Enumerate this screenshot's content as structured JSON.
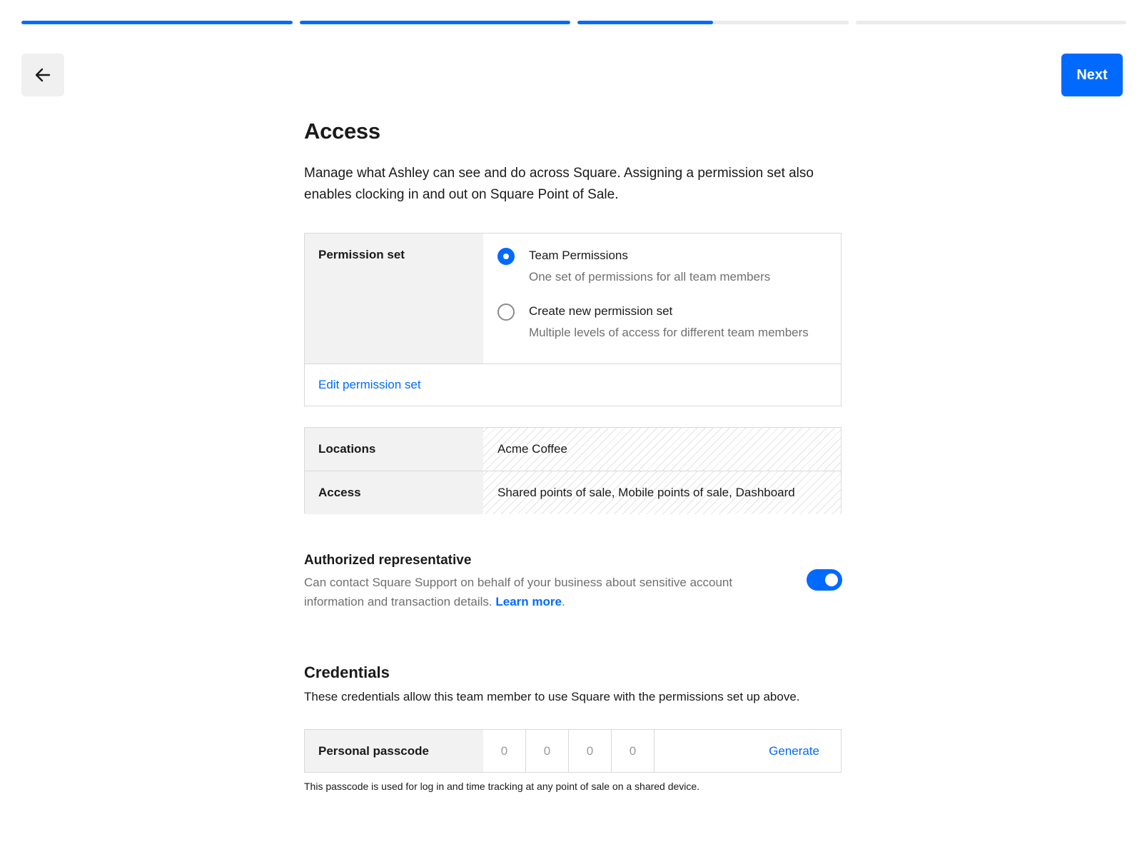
{
  "progress": {
    "segments": [
      {
        "fill": 1.0
      },
      {
        "fill": 1.0
      },
      {
        "fill": 0.5
      },
      {
        "fill": 0.0
      }
    ]
  },
  "header": {
    "back_icon": "arrow-left-icon",
    "next_label": "Next"
  },
  "page": {
    "title": "Access",
    "intro": "Manage what Ashley can see and do across Square. Assigning a permission set also enables clocking in and out on Square Point of Sale."
  },
  "permission": {
    "label": "Permission set",
    "options": [
      {
        "title": "Team Permissions",
        "description": "One set of permissions for all team members",
        "selected": true
      },
      {
        "title": "Create new permission set",
        "description": "Multiple levels of access for different team members",
        "selected": false
      }
    ],
    "edit_link": "Edit permission set"
  },
  "info": {
    "locations_label": "Locations",
    "locations_value": "Acme Coffee",
    "access_label": "Access",
    "access_value": "Shared points of sale, Mobile points of sale, Dashboard"
  },
  "authorized": {
    "title": "Authorized representative",
    "description": "Can contact Square Support on behalf of your business about sensitive account information and transaction details.",
    "learn_more": "Learn more",
    "period": ".",
    "enabled": true
  },
  "credentials": {
    "title": "Credentials",
    "description": "These credentials allow this team member to use Square with the permissions set up above.",
    "passcode_label": "Personal passcode",
    "digits": [
      "0",
      "0",
      "0",
      "0"
    ],
    "generate_label": "Generate",
    "note": "This passcode is used for log in and time tracking at any point of sale on a shared device."
  },
  "colors": {
    "accent": "#006aff",
    "muted_text": "#707070",
    "label_bg": "#f2f2f2"
  }
}
